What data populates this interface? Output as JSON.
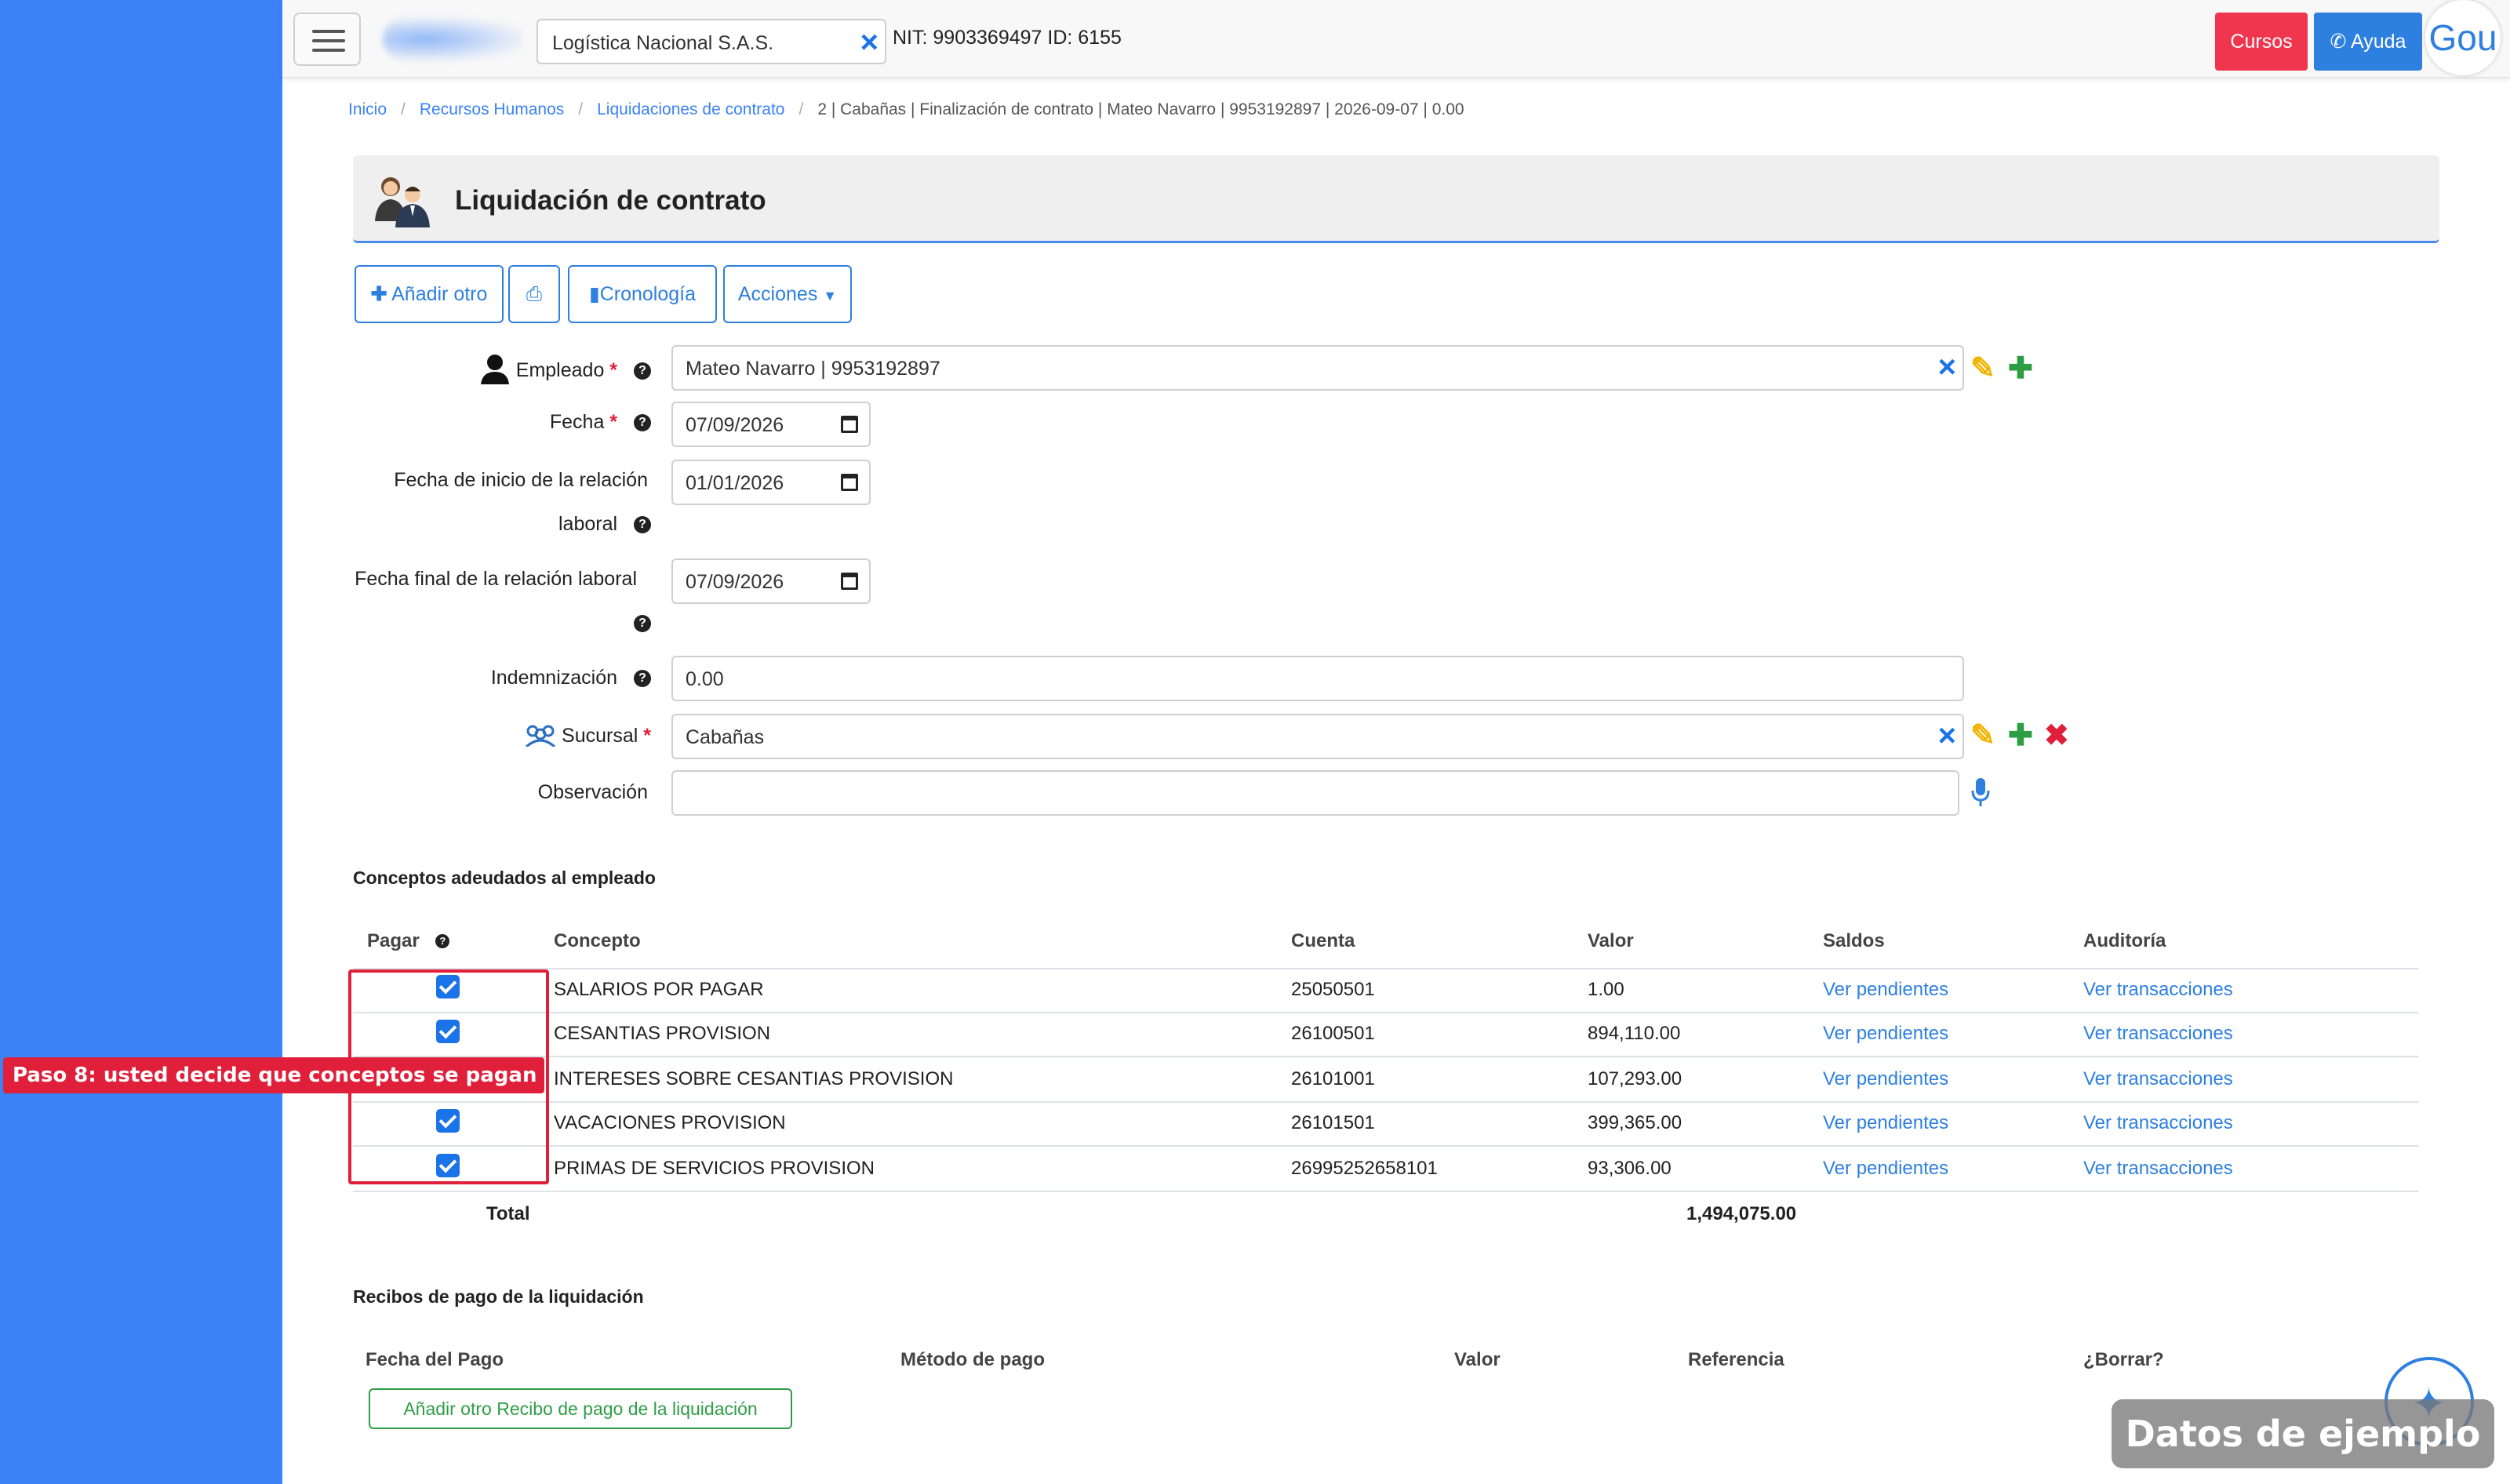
{
  "topbar": {
    "company": "Logística Nacional S.A.S.",
    "nit_text": "NIT: 9903369497 ID: 6155",
    "cursos_label": "Cursos",
    "ayuda_label": "Ayuda",
    "avatar_text": "Gou",
    "colors": {
      "cursos": "#f0364e",
      "ayuda": "#2d7fe0",
      "sidebar": "#3b82f6"
    }
  },
  "breadcrumb": {
    "items": [
      "Inicio",
      "Recursos Humanos",
      "Liquidaciones de contrato"
    ],
    "current": "2 | Cabañas | Finalización de contrato | Mateo Navarro | 9953192897 | 2026-09-07 | 0.00"
  },
  "header": {
    "title": "Liquidación de contrato"
  },
  "toolbar": {
    "add_label": "Añadir otro",
    "timeline_label": "Cronología",
    "actions_label": "Acciones"
  },
  "form": {
    "empleado": {
      "label": "Empleado",
      "value": "Mateo Navarro | 9953192897"
    },
    "fecha": {
      "label": "Fecha",
      "value": "07/09/2026"
    },
    "fecha_inicio": {
      "label_line1": "Fecha de inicio de la relación",
      "label_line2": "laboral",
      "value": "01/01/2026"
    },
    "fecha_final": {
      "label": "Fecha final de la relación laboral",
      "value": "07/09/2026"
    },
    "indemnizacion": {
      "label": "Indemnización",
      "value": "0.00"
    },
    "sucursal": {
      "label": "Sucursal",
      "value": "Cabañas"
    },
    "observacion": {
      "label": "Observación",
      "value": ""
    }
  },
  "conceptos": {
    "title": "Conceptos adeudados al empleado",
    "headers": {
      "pagar": "Pagar",
      "concepto": "Concepto",
      "cuenta": "Cuenta",
      "valor": "Valor",
      "saldos": "Saldos",
      "auditoria": "Auditoría"
    },
    "rows": [
      {
        "checked": true,
        "concepto": "SALARIOS POR PAGAR",
        "cuenta": "25050501",
        "valor": "1.00",
        "saldos": "Ver pendientes",
        "auditoria": "Ver transacciones"
      },
      {
        "checked": true,
        "concepto": "CESANTIAS PROVISION",
        "cuenta": "26100501",
        "valor": "894,110.00",
        "saldos": "Ver pendientes",
        "auditoria": "Ver transacciones"
      },
      {
        "checked": false,
        "concepto": "INTERESES SOBRE CESANTIAS PROVISION",
        "cuenta": "26101001",
        "valor": "107,293.00",
        "saldos": "Ver pendientes",
        "auditoria": "Ver transacciones"
      },
      {
        "checked": true,
        "concepto": "VACACIONES PROVISION",
        "cuenta": "26101501",
        "valor": "399,365.00",
        "saldos": "Ver pendientes",
        "auditoria": "Ver transacciones"
      },
      {
        "checked": true,
        "concepto": "PRIMAS DE SERVICIOS PROVISION",
        "cuenta": "26995252658101",
        "valor": "93,306.00",
        "saldos": "Ver pendientes",
        "auditoria": "Ver transacciones"
      }
    ],
    "total_label": "Total",
    "total_value": "1,494,075.00"
  },
  "callout": {
    "text": "Paso 8: usted decide que conceptos se pagan"
  },
  "recibos": {
    "title": "Recibos de pago de la liquidación",
    "headers": {
      "fecha": "Fecha del Pago",
      "metodo": "Método de pago",
      "valor": "Valor",
      "referencia": "Referencia",
      "borrar": "¿Borrar?"
    },
    "add_label": "Añadir otro Recibo de pago de la liquidación"
  },
  "watermark": {
    "text": "Datos de ejemplo"
  }
}
